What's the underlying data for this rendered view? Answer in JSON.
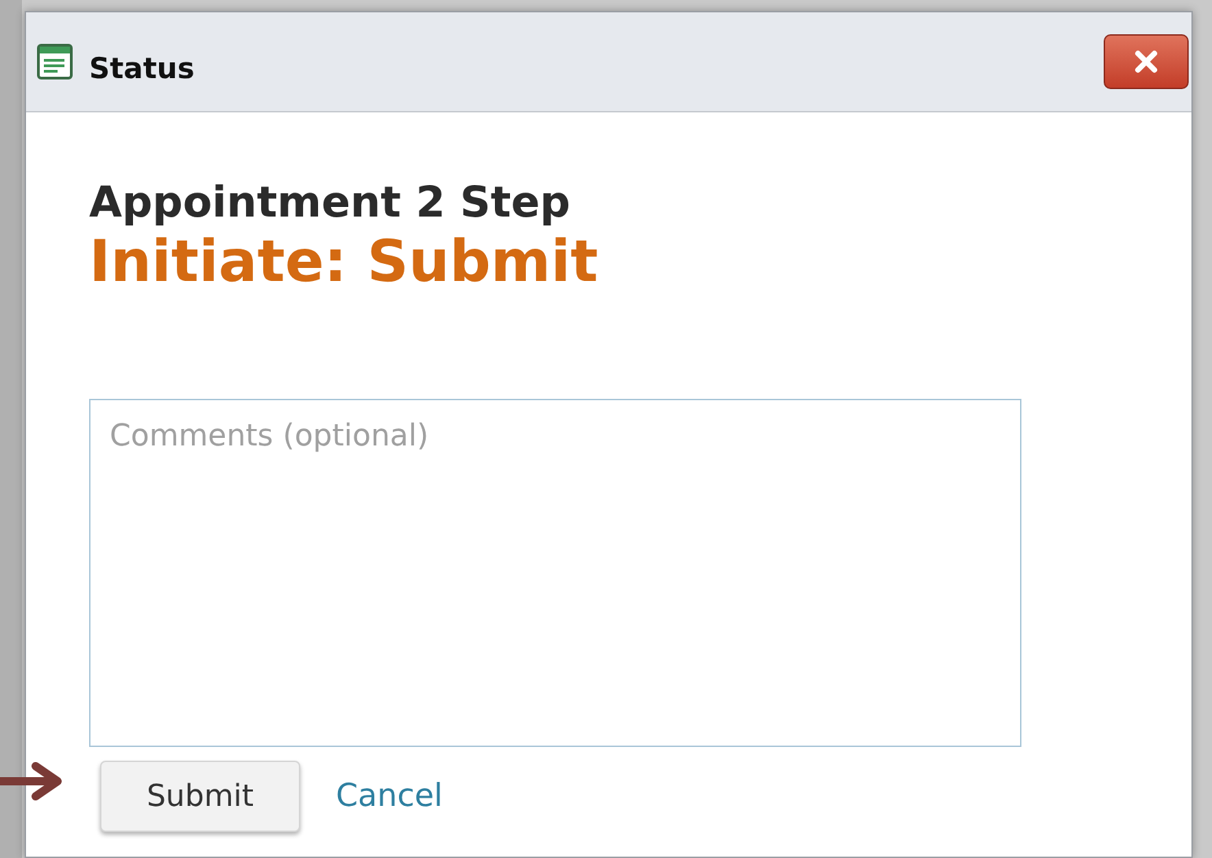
{
  "window": {
    "title": "Status"
  },
  "heading": "Appointment 2 Step",
  "subheading": "Initiate: Submit",
  "comments": {
    "placeholder": "Comments (optional)"
  },
  "buttons": [
    {
      "kind": "button",
      "label": "Submit"
    },
    {
      "kind": "link",
      "label": "Cancel"
    }
  ]
}
